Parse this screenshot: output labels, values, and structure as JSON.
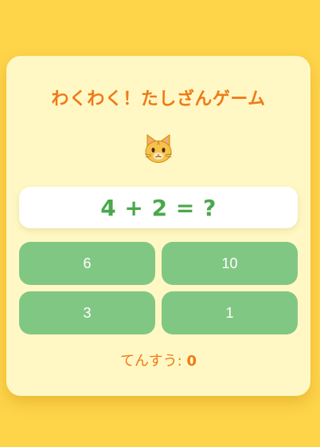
{
  "game": {
    "title": "わくわく！たしざんゲーム",
    "mascot_icon": "cat-face-icon",
    "question": "4 + 2 = ?",
    "answers": [
      "6",
      "10",
      "3",
      "1"
    ],
    "score_label": "てんすう:",
    "score_value": "0"
  },
  "colors": {
    "background": "#fed449",
    "card": "#fff8c4",
    "title": "#ef7a18",
    "question": "#4aa84c",
    "answer_button": "#81c784"
  }
}
